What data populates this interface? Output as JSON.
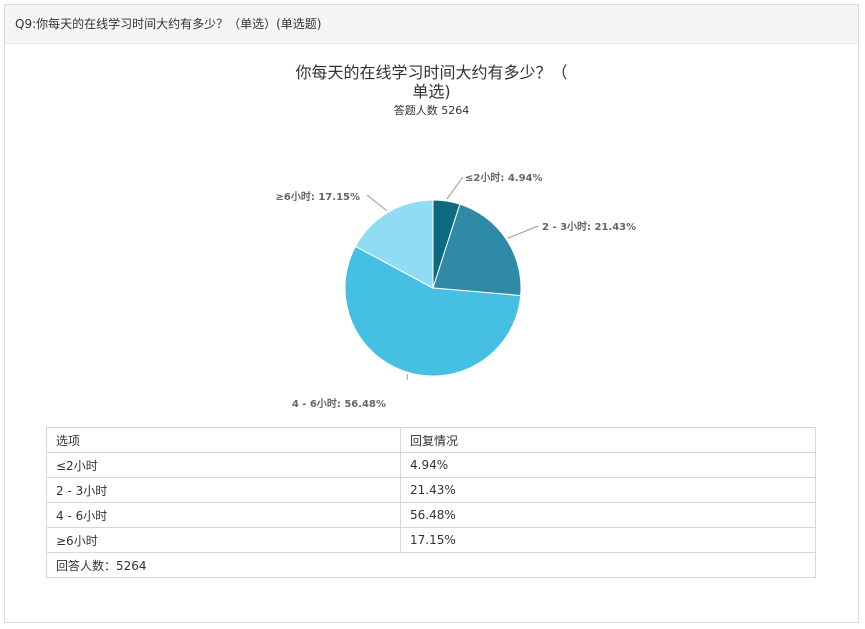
{
  "header": {
    "question": "Q9:你每天的在线学习时间大约有多少？（单选）(单选题)"
  },
  "chart_data": {
    "type": "pie",
    "title_line1": "你每天的在线学习时间大约有多少？（",
    "title_line2": "单选)",
    "subtitle_label": "答题人数",
    "subtitle_value": "5264",
    "slices": [
      {
        "label": "≤2小时",
        "value": 4.94,
        "value_text": "4.94%",
        "color": "#0e6a80"
      },
      {
        "label": "2 - 3小时",
        "value": 21.43,
        "value_text": "21.43%",
        "color": "#2e8aa6"
      },
      {
        "label": "4 - 6小时",
        "value": 56.48,
        "value_text": "56.48%",
        "color": "#45c0e2"
      },
      {
        "label": "≥6小时",
        "value": 17.15,
        "value_text": "17.15%",
        "color": "#8fdcf4"
      }
    ],
    "data_labels": [
      "≤2小时: 4.94%",
      "2 - 3小时: 21.43%",
      "4 - 6小时: 56.48%",
      "≥6小时: 17.15%"
    ]
  },
  "table": {
    "headers": [
      "选项",
      "回复情况"
    ],
    "rows": [
      [
        "≤2小时",
        "4.94%"
      ],
      [
        "2 - 3小时",
        "21.43%"
      ],
      [
        "4 - 6小时",
        "56.48%"
      ],
      [
        "≥6小时",
        "17.15%"
      ]
    ],
    "footer": "回答人数：5264"
  }
}
